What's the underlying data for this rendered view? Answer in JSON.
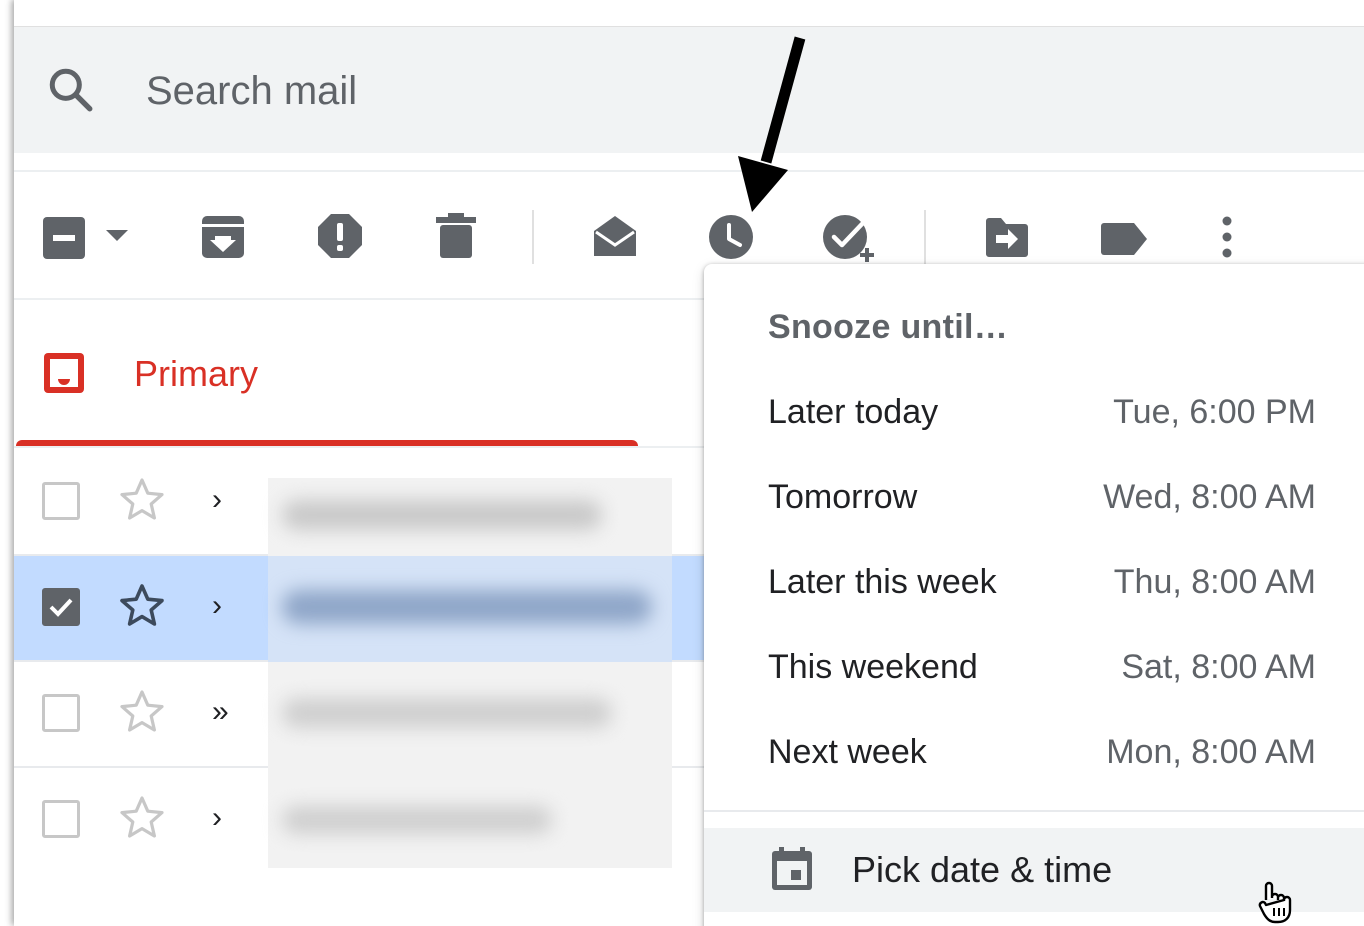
{
  "search": {
    "placeholder": "Search mail"
  },
  "toolbar": {
    "icons": [
      "select-checkbox-icon",
      "dropdown-caret-icon",
      "archive-icon",
      "report-spam-icon",
      "delete-icon",
      "mark-as-read-icon",
      "snooze-clock-icon",
      "add-to-tasks-icon",
      "move-to-icon",
      "label-icon",
      "more-options-icon"
    ]
  },
  "tabs": {
    "primary_label": "Primary"
  },
  "email_rows": [
    {
      "checked": false,
      "chevron": "›"
    },
    {
      "checked": true,
      "chevron": "›"
    },
    {
      "checked": false,
      "chevron": "»"
    },
    {
      "checked": false,
      "chevron": "›"
    }
  ],
  "snooze_menu": {
    "title": "Snooze until…",
    "options": [
      {
        "label": "Later today",
        "time": "Tue, 6:00 PM"
      },
      {
        "label": "Tomorrow",
        "time": "Wed, 8:00 AM"
      },
      {
        "label": "Later this week",
        "time": "Thu, 8:00 AM"
      },
      {
        "label": "This weekend",
        "time": "Sat, 8:00 AM"
      },
      {
        "label": "Next week",
        "time": "Mon, 8:00 AM"
      }
    ],
    "pick_label": "Pick date & time"
  },
  "colors": {
    "accent_red": "#d93025",
    "icon_gray": "#5f6368",
    "selected_row": "#c2dbff",
    "search_bg": "#f1f3f4"
  }
}
